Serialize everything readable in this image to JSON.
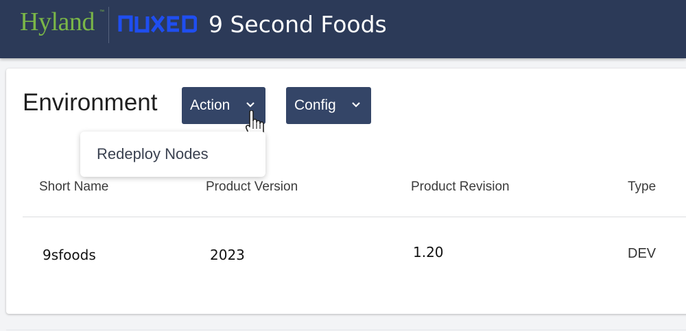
{
  "header": {
    "brand_primary": "Hyland",
    "brand_tm": "™",
    "brand_secondary": "NUXEO",
    "app_title": "9 Second Foods",
    "colors": {
      "bar": "#2c3a58",
      "hyland_green": "#7ab648",
      "nuxeo_blue": "#1f4ef0"
    }
  },
  "environment": {
    "title": "Environment",
    "action_button": {
      "label": "Action",
      "icon": "chevron-down-icon"
    },
    "config_button": {
      "label": "Config",
      "icon": "chevron-down-icon"
    },
    "action_menu": {
      "items": [
        "Redeploy Nodes"
      ]
    },
    "table": {
      "columns": [
        "Short Name",
        "Product Version",
        "Product Revision",
        "Type"
      ],
      "rows": [
        [
          "9sfoods",
          "2023",
          "1.20",
          "DEV"
        ]
      ]
    },
    "colors": {
      "button": "#344567"
    }
  }
}
